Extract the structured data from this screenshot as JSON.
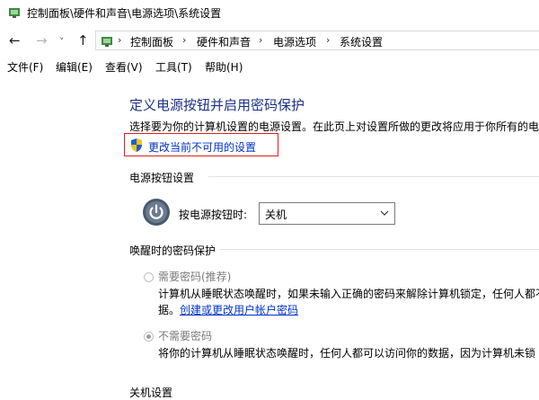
{
  "window": {
    "title": "控制面板\\硬件和声音\\电源选项\\系统设置"
  },
  "nav": {
    "back_glyph": "←",
    "forward_glyph": "→",
    "recent_glyph": "˅",
    "up_glyph": "↑",
    "breadcrumb": [
      "控制面板",
      "硬件和声音",
      "电源选项",
      "系统设置"
    ],
    "separator": "›"
  },
  "menu": [
    "文件(F)",
    "编辑(E)",
    "查看(V)",
    "工具(T)",
    "帮助(H)"
  ],
  "main": {
    "heading": "定义电源按钮并启用密码保护",
    "description": "选择要为你的计算机设置的电源设置。在此页上对设置所做的更改将应用于你所有的电",
    "change_link": "更改当前不可用的设置",
    "power_section": {
      "title": "电源按钮设置",
      "button_label": "按电源按钮时:",
      "button_value": "关机"
    },
    "password_section": {
      "title": "唤醒时的密码保护",
      "require": {
        "label": "需要密码(推荐)",
        "line1": "计算机从睡眠状态唤醒时，如果未输入正确的密码来解除计算机锁定，任何人都不",
        "line2_prefix": "据。",
        "line2_link": "创建或更改用户帐户密码"
      },
      "no_require": {
        "label": "不需要密码",
        "line1": "将你的计算机从睡眠状态唤醒时，任何人都可以访问你的数据，因为计算机未锁"
      }
    },
    "shutdown_section": {
      "title": "关机设置"
    }
  },
  "colors": {
    "heading": "#1e3287",
    "link": "#0033cc",
    "highlight_box": "#e0201b"
  }
}
